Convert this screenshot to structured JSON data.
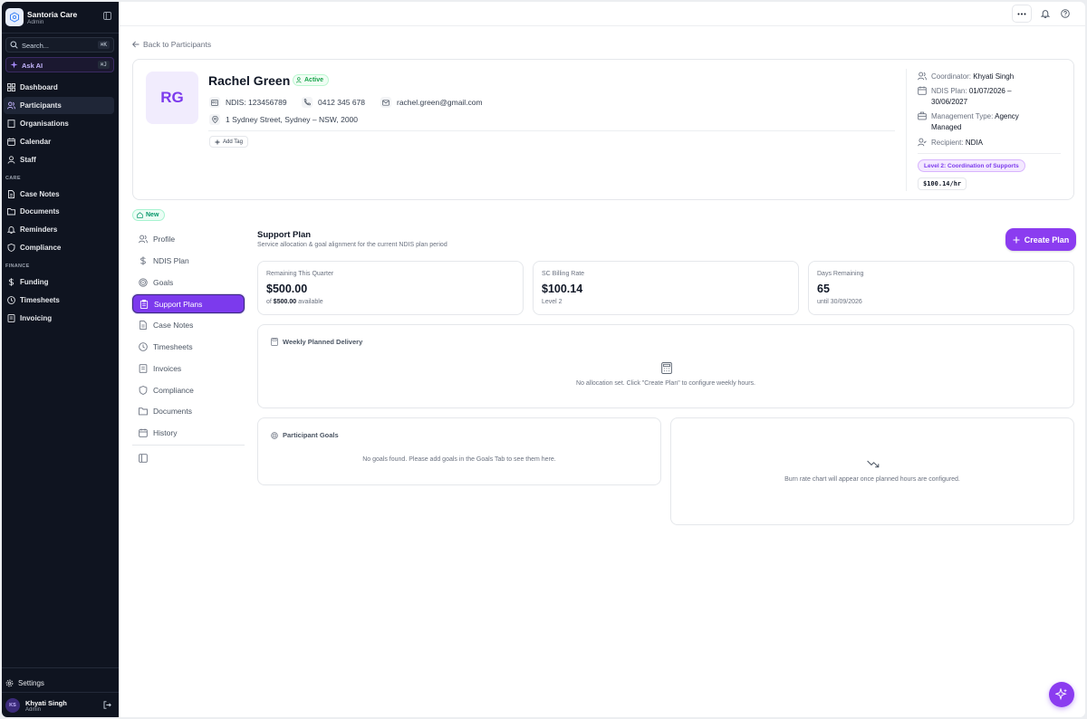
{
  "sidebar": {
    "brand_name": "Santoria Care",
    "brand_role": "Admin",
    "search_label": "Search...",
    "search_shortcut": "⌘K",
    "ask_ai_label": "Ask AI",
    "ask_ai_shortcut": "⌘J",
    "main_items": [
      {
        "label": "Dashboard",
        "icon": "dashboard-icon"
      },
      {
        "label": "Participants",
        "icon": "users-icon",
        "active": true
      },
      {
        "label": "Organisations",
        "icon": "building-icon"
      },
      {
        "label": "Calendar",
        "icon": "calendar-icon"
      },
      {
        "label": "Staff",
        "icon": "user-icon"
      }
    ],
    "care_section": "CARE",
    "care_items": [
      {
        "label": "Case Notes",
        "icon": "file-text-icon"
      },
      {
        "label": "Documents",
        "icon": "folder-icon"
      },
      {
        "label": "Reminders",
        "icon": "bell-icon"
      },
      {
        "label": "Compliance",
        "icon": "shield-icon"
      }
    ],
    "finance_section": "FINANCE",
    "finance_items": [
      {
        "label": "Funding",
        "icon": "dollar-icon"
      },
      {
        "label": "Timesheets",
        "icon": "clock-icon"
      },
      {
        "label": "Invoicing",
        "icon": "receipt-icon"
      }
    ],
    "settings_label": "Settings",
    "user": {
      "initials": "KS",
      "name": "Khyati Singh",
      "role": "Admin"
    }
  },
  "back_link": "Back to Participants",
  "participant": {
    "initials": "RG",
    "name": "Rachel Green",
    "status": "Active",
    "ndis": "NDIS: 123456789",
    "phone": "0412 345 678",
    "email": "rachel.green@gmail.com",
    "address": "1 Sydney Street, Sydney – NSW, 2000",
    "add_tag": "Add Tag"
  },
  "meta": {
    "coordinator_label": "Coordinator:",
    "coordinator": "Khyati Singh",
    "plan_label": "NDIS Plan:",
    "plan_start": "01/07/2026 –",
    "plan_end": "30/06/2027",
    "mgmt_label": "Management Type:",
    "mgmt_value1": "Agency",
    "mgmt_value2": "Managed",
    "recipient_label": "Recipient:",
    "recipient": "NDIA",
    "level": "Level 2: Coordination of Supports",
    "rate": "$100.14/hr"
  },
  "new_badge": "New",
  "subnav": [
    {
      "label": "Profile",
      "icon": "user-icon"
    },
    {
      "label": "NDIS Plan",
      "icon": "dollar-icon"
    },
    {
      "label": "Goals",
      "icon": "target-icon"
    },
    {
      "label": "Support Plans",
      "icon": "clipboard-icon",
      "active": true
    },
    {
      "label": "Case Notes",
      "icon": "file-text-icon"
    },
    {
      "label": "Timesheets",
      "icon": "clock-icon"
    },
    {
      "label": "Invoices",
      "icon": "receipt-icon"
    },
    {
      "label": "Compliance",
      "icon": "shield-icon"
    },
    {
      "label": "Documents",
      "icon": "folder-icon"
    },
    {
      "label": "History",
      "icon": "calendar-icon"
    }
  ],
  "support_plan": {
    "title": "Support Plan",
    "subtitle": "Service allocation & goal alignment for the current NDIS plan period",
    "create_label": "Create Plan",
    "stats": [
      {
        "label": "Remaining This Quarter",
        "value": "$500.00",
        "sub_prefix": "of",
        "sub_bold": "$500.00",
        "sub_suffix": "available"
      },
      {
        "label": "SC Billing Rate",
        "value": "$100.14",
        "sub": "Level 2"
      },
      {
        "label": "Days Remaining",
        "value": "65",
        "sub": "until 30/09/2026"
      }
    ],
    "weekly_title": "Weekly Planned Delivery",
    "weekly_empty": "No allocation set. Click \"Create Plan\" to configure weekly hours.",
    "goals_title": "Participant Goals",
    "goals_empty": "No goals found. Please add goals in the Goals Tab to see them here.",
    "burn_empty": "Burn rate chart will appear once planned hours are configured."
  },
  "colors": {
    "accent": "#7c3aed",
    "sidebar_bg": "#0f1420",
    "active_green": "#16a34a"
  }
}
